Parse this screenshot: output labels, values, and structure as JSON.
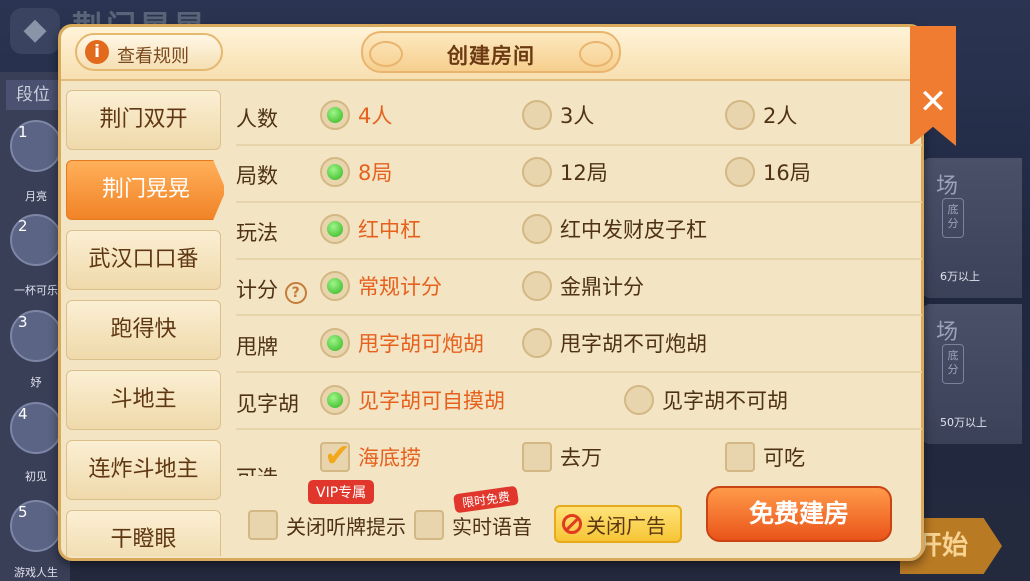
{
  "background": {
    "title": "荆门晃晃",
    "back_icon": "back-icon",
    "sidebar_header": "段位",
    "ranks": [
      {
        "num": "1",
        "name": "月亮"
      },
      {
        "num": "2",
        "name": "一杯可乐"
      },
      {
        "num": "3",
        "name": "妤"
      },
      {
        "num": "4",
        "name": "初见"
      },
      {
        "num": "5",
        "name": "游戏人生"
      }
    ],
    "cards": [
      {
        "chang": "场",
        "di": "底分",
        "req": "6万以上"
      },
      {
        "chang": "场",
        "di": "底分",
        "req": "50万以上"
      }
    ],
    "start_label": "开始"
  },
  "dialog": {
    "rules_icon": "info-icon",
    "rules_label": "查看规则",
    "title": "创建房间",
    "close_icon": "close-icon",
    "tabs": [
      {
        "label": "荆门双开",
        "active": false
      },
      {
        "label": "荆门晃晃",
        "active": true
      },
      {
        "label": "武汉口口番",
        "active": false
      },
      {
        "label": "跑得快",
        "active": false
      },
      {
        "label": "斗地主",
        "active": false
      },
      {
        "label": "连炸斗地主",
        "active": false
      },
      {
        "label": "干瞪眼",
        "active": false
      }
    ],
    "rows": {
      "players": {
        "label": "人数",
        "options": [
          "4人",
          "3人",
          "2人"
        ],
        "selected": 0
      },
      "rounds": {
        "label": "局数",
        "options": [
          "8局",
          "12局",
          "16局"
        ],
        "selected": 0
      },
      "play": {
        "label": "玩法",
        "options": [
          "红中杠",
          "红中发财皮子杠"
        ],
        "selected": 0
      },
      "scoring": {
        "label": "计分",
        "help_icon": "help-icon",
        "help_text": "?",
        "options": [
          "常规计分",
          "金鼎计分"
        ],
        "selected": 0
      },
      "throw": {
        "label": "甩牌",
        "options": [
          "甩字胡可炮胡",
          "甩字胡不可炮胡"
        ],
        "selected": 0
      },
      "jianzi": {
        "label": "见字胡",
        "options": [
          "见字胡可自摸胡",
          "见字胡不可胡"
        ],
        "selected": 0
      },
      "extra": {
        "label": "可选",
        "options": [
          "海底捞",
          "去万",
          "可吃"
        ],
        "checked": [
          true,
          false,
          false
        ]
      }
    },
    "bottom": {
      "vip_badge": "VIP专属",
      "ting_label": "关闭听牌提示",
      "free_badge": "限时免费",
      "voice_label": "实时语音",
      "noad_icon": "ban-icon",
      "noad_label": "关闭广告",
      "create_label": "免费建房"
    }
  }
}
